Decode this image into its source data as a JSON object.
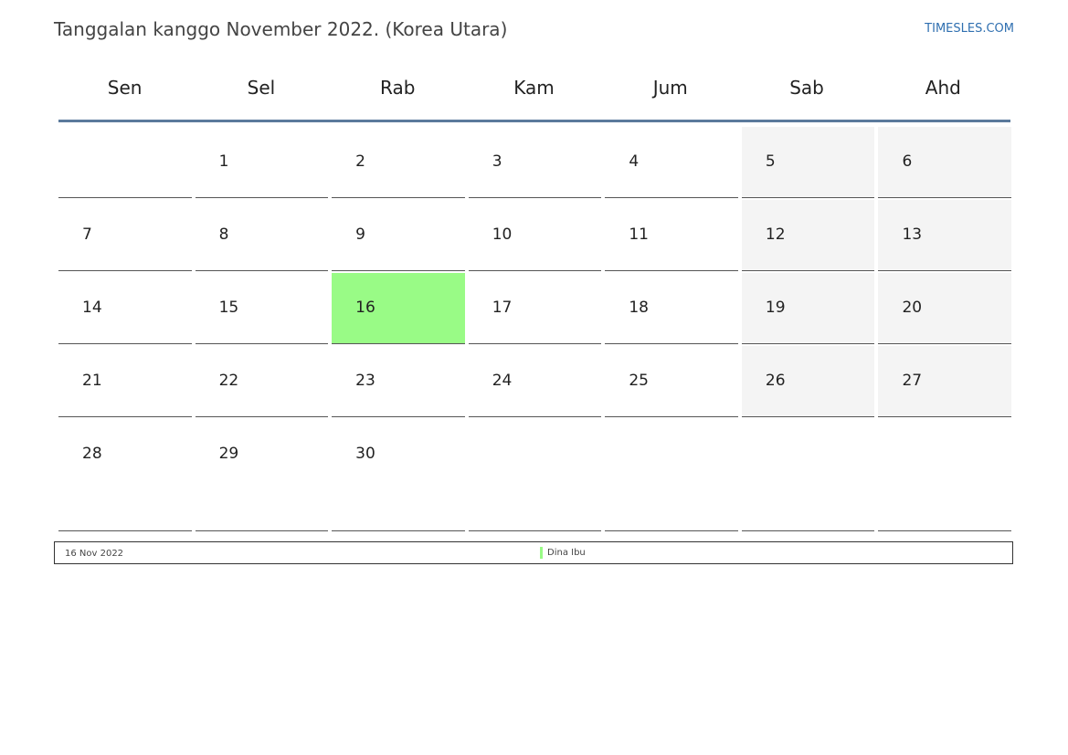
{
  "title": "Tanggalan kanggo November 2022. (Korea Utara)",
  "site": "TIMESLES.COM",
  "colors": {
    "highlight": "#99fb86",
    "weekend": "#f4f4f4",
    "accent": "#5b7a9c",
    "link": "#2f6fb0"
  },
  "weekdays": [
    "Sen",
    "Sel",
    "Rab",
    "Kam",
    "Jum",
    "Sab",
    "Ahd"
  ],
  "weeks": [
    [
      "",
      "1",
      "2",
      "3",
      "4",
      "5",
      "6"
    ],
    [
      "7",
      "8",
      "9",
      "10",
      "11",
      "12",
      "13"
    ],
    [
      "14",
      "15",
      "16",
      "17",
      "18",
      "19",
      "20"
    ],
    [
      "21",
      "22",
      "23",
      "24",
      "25",
      "26",
      "27"
    ],
    [
      "28",
      "29",
      "30",
      "",
      "",
      "",
      ""
    ]
  ],
  "highlighted_day": "16",
  "legend": {
    "date": "16 Nov 2022",
    "event": "Dina Ibu"
  }
}
